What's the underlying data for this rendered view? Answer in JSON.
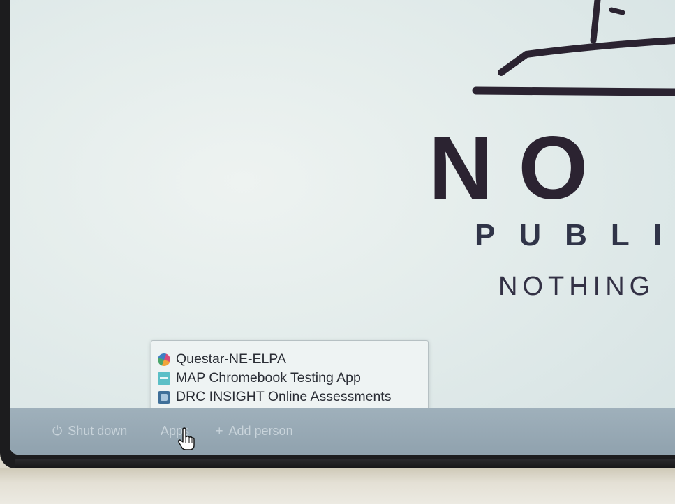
{
  "wallpaper": {
    "logo_big_text": "NO",
    "logo_public_text": "PUBLI",
    "logo_tagline": "NOTHING"
  },
  "apps_menu": {
    "items": [
      {
        "label": "Questar-NE-ELPA",
        "icon": "questar-app-icon"
      },
      {
        "label": "MAP Chromebook Testing App",
        "icon": "map-app-icon"
      },
      {
        "label": "DRC INSIGHT Online Assessments",
        "icon": "drc-app-icon"
      }
    ]
  },
  "shelf": {
    "shutdown_label": "Shut down",
    "apps_label": "Apps",
    "add_person_label": "Add person"
  },
  "colors": {
    "shelf": "#96a8b4",
    "screen": "#e3eceb",
    "logo": "#2b2331"
  }
}
